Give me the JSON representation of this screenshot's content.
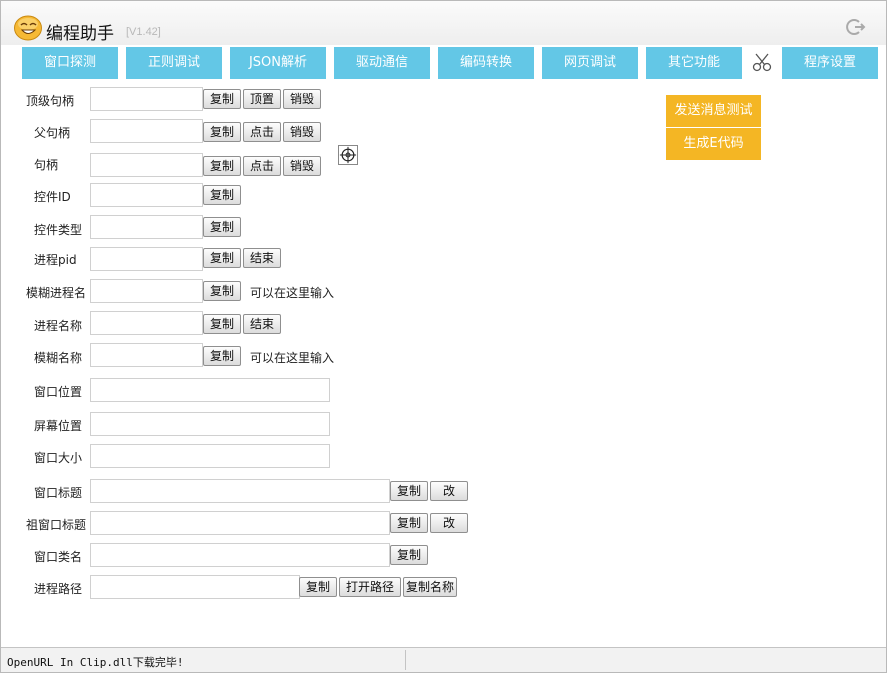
{
  "window": {
    "title": "编程助手",
    "version": "[V1.42]"
  },
  "tabs": [
    {
      "label": "窗口探测"
    },
    {
      "label": "正则调试"
    },
    {
      "label": "JSON解析"
    },
    {
      "label": "驱动通信"
    },
    {
      "label": "编码转换"
    },
    {
      "label": "网页调试"
    },
    {
      "label": "其它功能"
    },
    {
      "label": "程序设置"
    }
  ],
  "colors": {
    "tab_bg": "#63c7e6",
    "accent_orange": "#f4b624"
  },
  "form": {
    "top_handle": {
      "label": "顶级句柄",
      "value": "",
      "copy": "复制",
      "topmost": "顶置",
      "destroy": "销毁"
    },
    "parent_handle": {
      "label": "父句柄",
      "value": "",
      "copy": "复制",
      "click": "点击",
      "destroy": "销毁"
    },
    "handle": {
      "label": "句柄",
      "value": "",
      "copy": "复制",
      "click": "点击",
      "destroy": "销毁"
    },
    "control_id": {
      "label": "控件ID",
      "value": "",
      "copy": "复制"
    },
    "control_type": {
      "label": "控件类型",
      "value": "",
      "copy": "复制"
    },
    "process_pid": {
      "label": "进程pid",
      "value": "",
      "copy": "复制",
      "end": "结束"
    },
    "fuzzy_process": {
      "label": "模糊进程名",
      "value": "",
      "copy": "复制",
      "hint": "可以在这里输入"
    },
    "process_name": {
      "label": "进程名称",
      "value": "",
      "copy": "复制",
      "end": "结束"
    },
    "fuzzy_name": {
      "label": "模糊名称",
      "value": "",
      "copy": "复制",
      "hint": "可以在这里输入"
    },
    "window_pos": {
      "label": "窗口位置",
      "value": ""
    },
    "screen_pos": {
      "label": "屏幕位置",
      "value": ""
    },
    "window_size": {
      "label": "窗口大小",
      "value": ""
    },
    "window_title": {
      "label": "窗口标题",
      "value": "",
      "copy": "复制",
      "change": "改"
    },
    "root_title": {
      "label": "祖窗口标题",
      "value": "",
      "copy": "复制",
      "change": "改"
    },
    "window_class": {
      "label": "窗口类名",
      "value": "",
      "copy": "复制"
    },
    "process_path": {
      "label": "进程路径",
      "value": "",
      "copy": "复制",
      "open": "打开路径",
      "copy_name": "复制名称"
    }
  },
  "side_actions": {
    "send_message": "发送消息测试",
    "gen_code": "生成E代码"
  },
  "status": {
    "message": "OpenURL In Clip.dll下载完毕!"
  }
}
